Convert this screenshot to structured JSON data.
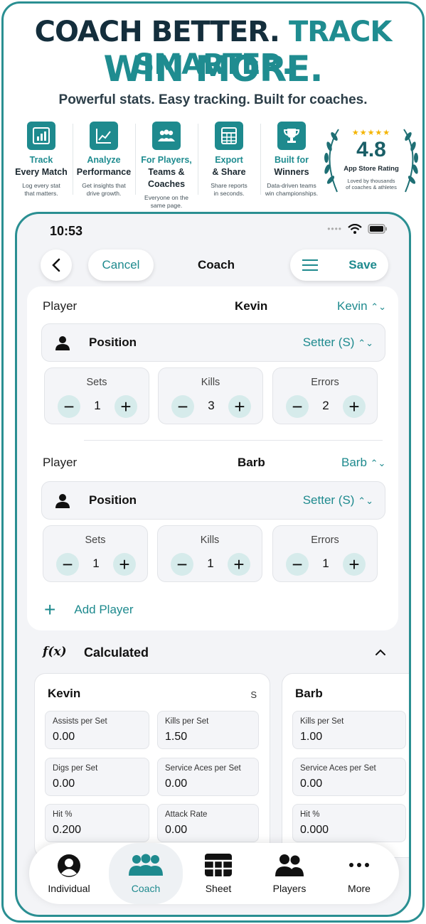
{
  "hero": {
    "title_part1": "COACH BETTER.",
    "title_part2": "TRACK SMARTER.",
    "title_line2": "WIN MORE.",
    "subtitle": "Powerful stats. Easy tracking. Built for coaches."
  },
  "features": [
    {
      "title1": "Track",
      "title2": "Every Match",
      "desc1": "Log every stat",
      "desc2": "that matters.",
      "icon": "bar-chart-icon"
    },
    {
      "title1": "Analyze",
      "title2": "Performance",
      "desc1": "Get insights that",
      "desc2": "drive growth.",
      "icon": "trend-chart-icon"
    },
    {
      "title1": "For Players,",
      "title2": "Teams & Coaches",
      "desc1": "Everyone on the",
      "desc2": "same page.",
      "icon": "group-icon"
    },
    {
      "title1": "Export",
      "title2": "& Share",
      "desc1": "Share reports",
      "desc2": "in seconds.",
      "icon": "spreadsheet-icon"
    },
    {
      "title1": "Built for",
      "title2": "Winners",
      "desc1": "Data-driven teams",
      "desc2": "win championships.",
      "icon": "trophy-icon"
    }
  ],
  "rating": {
    "stars": "★★★★★",
    "value": "4.8",
    "label": "App Store Rating",
    "desc1": "Loved by thousands",
    "desc2": "of coaches & athletes"
  },
  "status": {
    "time": "10:53"
  },
  "nav": {
    "cancel": "Cancel",
    "title": "Coach",
    "save": "Save"
  },
  "players": [
    {
      "label": "Player",
      "name": "Kevin",
      "selected": "Kevin",
      "position_label": "Position",
      "position_value": "Setter (S)",
      "stats": [
        {
          "name": "Sets",
          "value": "1"
        },
        {
          "name": "Kills",
          "value": "3"
        },
        {
          "name": "Errors",
          "value": "2"
        }
      ]
    },
    {
      "label": "Player",
      "name": "Barb",
      "selected": "Barb",
      "position_label": "Position",
      "position_value": "Setter (S)",
      "stats": [
        {
          "name": "Sets",
          "value": "1"
        },
        {
          "name": "Kills",
          "value": "1"
        },
        {
          "name": "Errors",
          "value": "1"
        }
      ]
    }
  ],
  "add_player": "Add Player",
  "calculated": {
    "icon_text": "f(x)",
    "title": "Calculated",
    "cards": [
      {
        "name": "Kevin",
        "position": "S",
        "metrics": [
          {
            "label": "Assists per Set",
            "value": "0.00"
          },
          {
            "label": "Kills per Set",
            "value": "1.50"
          },
          {
            "label": "Digs per Set",
            "value": "0.00"
          },
          {
            "label": "Service Aces per Set",
            "value": "0.00"
          },
          {
            "label": "Hit %",
            "value": "0.200"
          },
          {
            "label": "Attack Rate",
            "value": "0.00"
          }
        ]
      },
      {
        "name": "Barb",
        "metrics": [
          {
            "label": "Kills per Set",
            "value": "1.00"
          },
          {
            "label": "Service Aces per Set",
            "value": "0.00"
          },
          {
            "label": "Hit %",
            "value": "0.000"
          }
        ]
      }
    ]
  },
  "tabs": [
    {
      "label": "Individual",
      "icon": "person-circle-icon"
    },
    {
      "label": "Coach",
      "icon": "team-icon",
      "active": true
    },
    {
      "label": "Sheet",
      "icon": "grid-icon"
    },
    {
      "label": "Players",
      "icon": "players-icon"
    },
    {
      "label": "More",
      "icon": "ellipsis-icon"
    }
  ],
  "colors": {
    "accent": "#1e8a8e",
    "dark": "#142e3c",
    "star": "#f4b400"
  }
}
